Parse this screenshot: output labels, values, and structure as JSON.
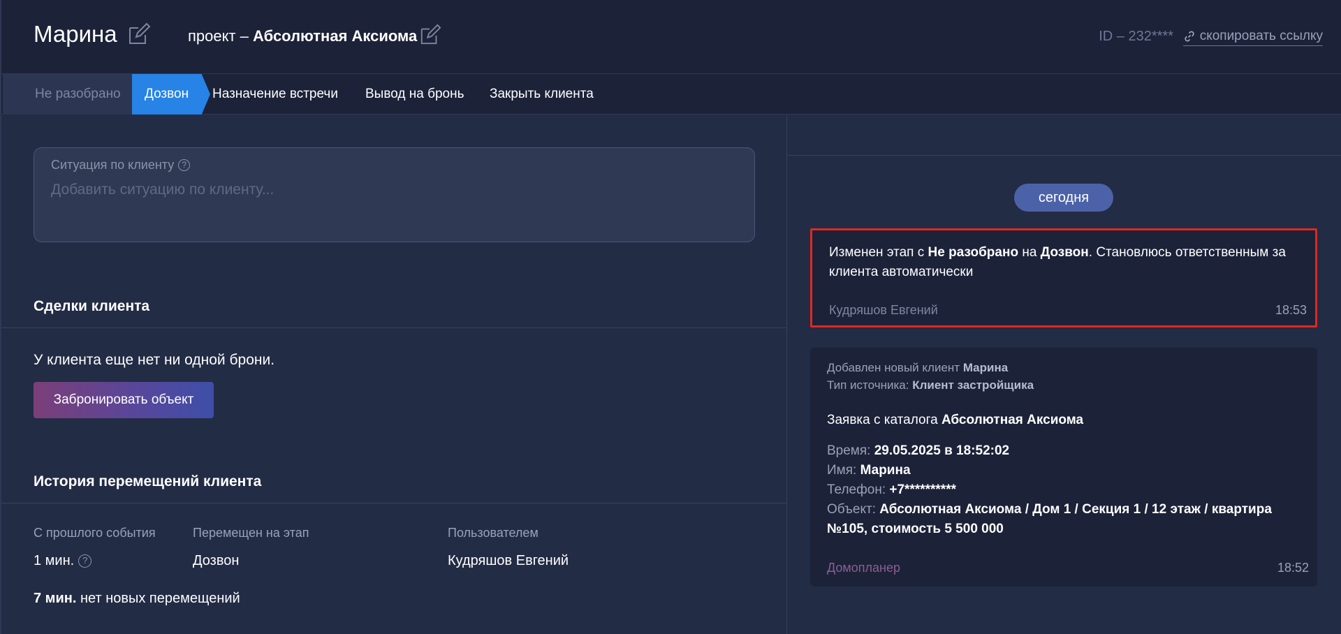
{
  "header": {
    "client_name": "Марина",
    "project_prefix": "проект –",
    "project_name": "Абсолютная Аксиома",
    "id_label": "ID – 232****",
    "copy_link_label": "скопировать ссылку"
  },
  "stages": [
    {
      "label": "Не разобрано",
      "state": "done"
    },
    {
      "label": "Дозвон",
      "state": "active"
    },
    {
      "label": "Назначение встречи",
      "state": "pending"
    },
    {
      "label": "Вывод на бронь",
      "state": "pending"
    },
    {
      "label": "Закрыть клиента",
      "state": "pending"
    }
  ],
  "situation": {
    "label": "Ситуация по клиенту",
    "placeholder": "Добавить ситуацию по клиенту..."
  },
  "deals": {
    "title": "Сделки клиента",
    "empty_text": "У клиента еще нет ни одной брони.",
    "book_button": "Забронировать объект"
  },
  "history": {
    "title": "История перемещений клиента",
    "columns": [
      "С прошлого события",
      "Перемещен на этап",
      "Пользователем"
    ],
    "rows": [
      {
        "since": "1 мин.",
        "stage": "Дозвон",
        "user": "Кудряшов Евгений"
      }
    ],
    "footer_bold": "7 мин.",
    "footer_text": "нет новых перемещений"
  },
  "feed": {
    "day_label": "сегодня",
    "events": [
      {
        "t1": "Изменен этап с ",
        "b1": "Не разобрано",
        "t2": " на ",
        "b2": "Дозвон",
        "t3": ". Становлюсь ответственным за клиента автоматически",
        "author": "Кудряшов Евгений",
        "time": "18:53"
      },
      {
        "added_label": "Добавлен новый клиент",
        "added_value": "Марина",
        "source_label": "Тип источника:",
        "source_value": "Клиент застройщика",
        "request_label": "Заявка с каталога",
        "request_value": "Абсолютная Аксиома",
        "time_label": "Время:",
        "time_value": "29.05.2025 в 18:52:02",
        "name_label": "Имя:",
        "name_value": "Марина",
        "phone_label": "Телефон:",
        "phone_value": "+7**********",
        "object_label": "Объект:",
        "object_value": "Абсолютная Аксиома / Дом 1 / Секция 1 / 12 этаж / квартира №105, стоимость 5 500 000",
        "author": "Домопланер",
        "time": "18:52"
      }
    ]
  },
  "colors": {
    "accent": "#2783e6",
    "highlight_border": "#e0281e",
    "background": "#232c45",
    "panel": "#1c2238"
  }
}
